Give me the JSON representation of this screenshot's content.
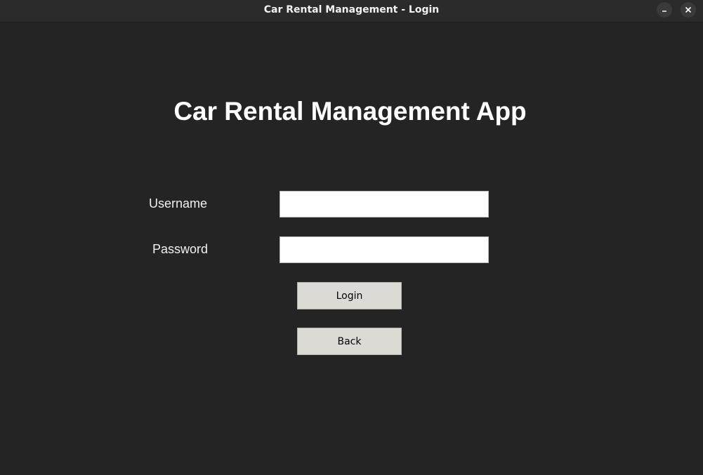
{
  "window": {
    "title": "Car Rental Management - Login",
    "controls": [
      {
        "name": "minimize",
        "icon": "minimize-icon",
        "glyph": "–"
      },
      {
        "name": "close",
        "icon": "close-icon",
        "glyph": "✕"
      }
    ]
  },
  "header": {
    "title": "Car Rental Management App"
  },
  "form": {
    "username_label": "Username",
    "username_value": "",
    "password_label": "Password",
    "password_value": "",
    "login_label": "Login",
    "back_label": "Back"
  },
  "colors": {
    "background": "#242424",
    "titlebar": "#2b2b2b",
    "button_bg": "#dcdad5",
    "field_bg": "#ffffff",
    "text": "#ffffff"
  }
}
